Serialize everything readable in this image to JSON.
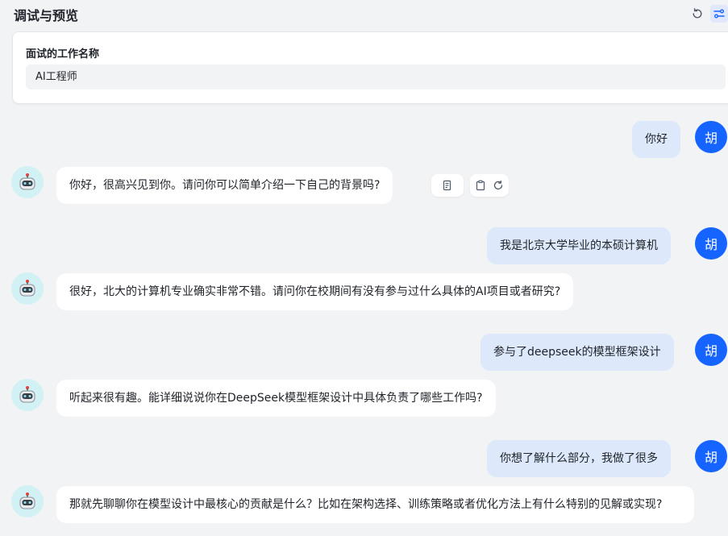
{
  "header": {
    "title": "调试与预览",
    "refresh_icon": "refresh-icon",
    "settings_icon": "settings-sliders-icon"
  },
  "variables": {
    "label": "面试的工作名称",
    "value": "AI工程师"
  },
  "messages": [
    {
      "role": "user",
      "avatar": "胡",
      "text": "你好"
    },
    {
      "role": "bot",
      "text": "你好，很高兴见到你。请问你可以简单介绍一下自己的背景吗?"
    },
    {
      "role": "user",
      "avatar": "胡",
      "text": "我是北京大学毕业的本硕计算机"
    },
    {
      "role": "bot",
      "text": "很好，北大的计算机专业确实非常不错。请问你在校期间有没有参与过什么具体的AI项目或者研究?"
    },
    {
      "role": "user",
      "avatar": "胡",
      "text": "参与了deepseek的模型框架设计"
    },
    {
      "role": "bot",
      "text": "听起来很有趣。能详细说说你在DeepSeek模型框架设计中具体负责了哪些工作吗?"
    },
    {
      "role": "user",
      "avatar": "胡",
      "text": "你想了解什么部分，我做了很多"
    },
    {
      "role": "bot",
      "text": "那就先聊聊你在模型设计中最核心的贡献是什么？比如在架构选择、训练策略或者优化方法上有什么特别的见解或实现?"
    }
  ],
  "colors": {
    "accent": "#1664ff",
    "user_bubble": "#dde8fb",
    "bot_avatar_bg": "#d2f1f4"
  }
}
